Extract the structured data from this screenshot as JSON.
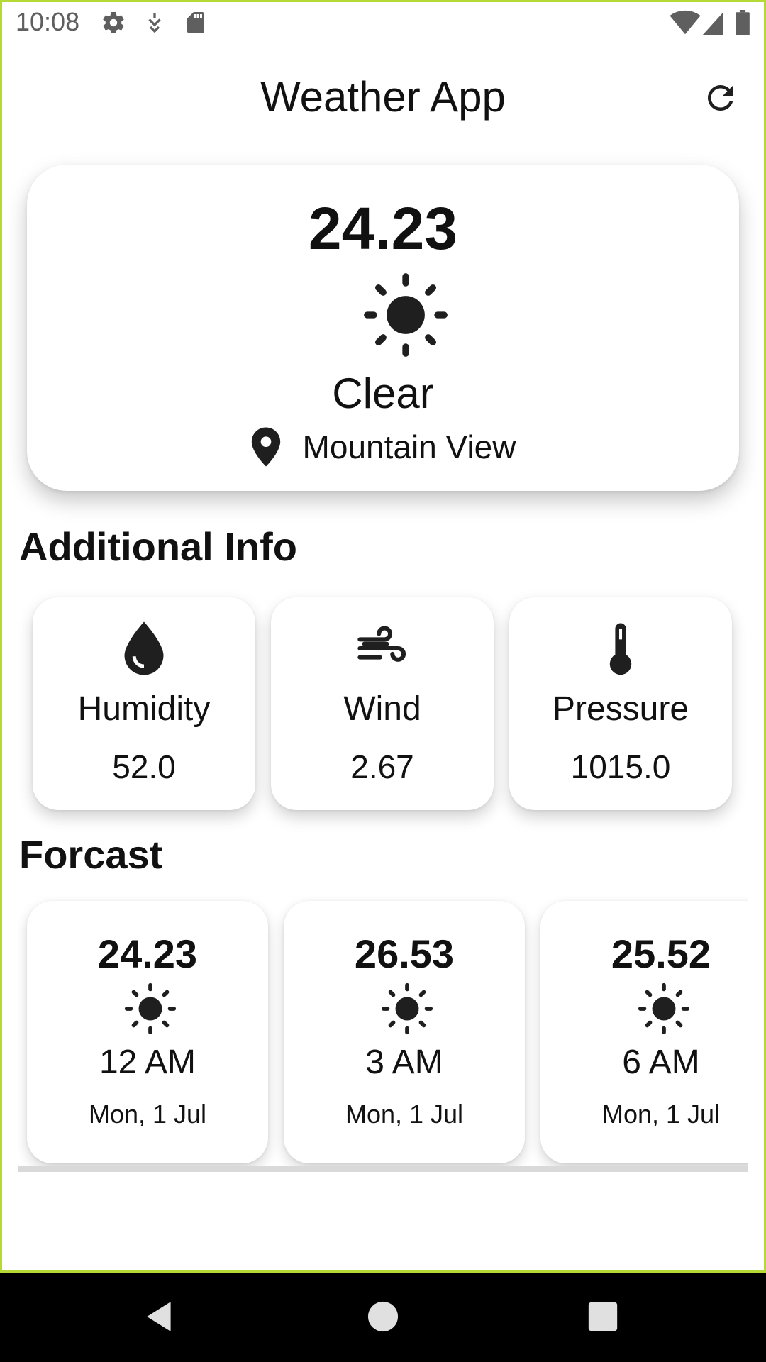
{
  "status_bar": {
    "time": "10:08",
    "left_icons": [
      "settings-icon",
      "download-icon",
      "sd-card-icon"
    ],
    "right_icons": [
      "wifi-icon",
      "signal-icon",
      "battery-icon"
    ]
  },
  "app_bar": {
    "title": "Weather App",
    "action_icon": "refresh-icon"
  },
  "current": {
    "temperature": "24.23",
    "icon": "sun-icon",
    "condition": "Clear",
    "location_icon": "location-pin-icon",
    "location": "Mountain View"
  },
  "additional_info": {
    "title": "Additional Info",
    "items": [
      {
        "icon": "water-drop-icon",
        "label": "Humidity",
        "value": "52.0"
      },
      {
        "icon": "wind-icon",
        "label": "Wind",
        "value": "2.67"
      },
      {
        "icon": "thermometer-icon",
        "label": "Pressure",
        "value": "1015.0"
      }
    ]
  },
  "forecast": {
    "title": "Forcast",
    "items": [
      {
        "temperature": "24.23",
        "icon": "sun-icon",
        "time": "12 AM",
        "date": "Mon, 1 Jul"
      },
      {
        "temperature": "26.53",
        "icon": "sun-icon",
        "time": "3 AM",
        "date": "Mon, 1 Jul"
      },
      {
        "temperature": "25.52",
        "icon": "sun-icon",
        "time": "6 AM",
        "date": "Mon, 1 Jul"
      }
    ]
  },
  "nav_bar": {
    "buttons": [
      "back-icon",
      "home-icon",
      "recents-icon"
    ]
  },
  "colors": {
    "frame_border": "#b5d935",
    "icon_dark": "#1f1f1f",
    "status_gray": "#5f5f5f"
  }
}
